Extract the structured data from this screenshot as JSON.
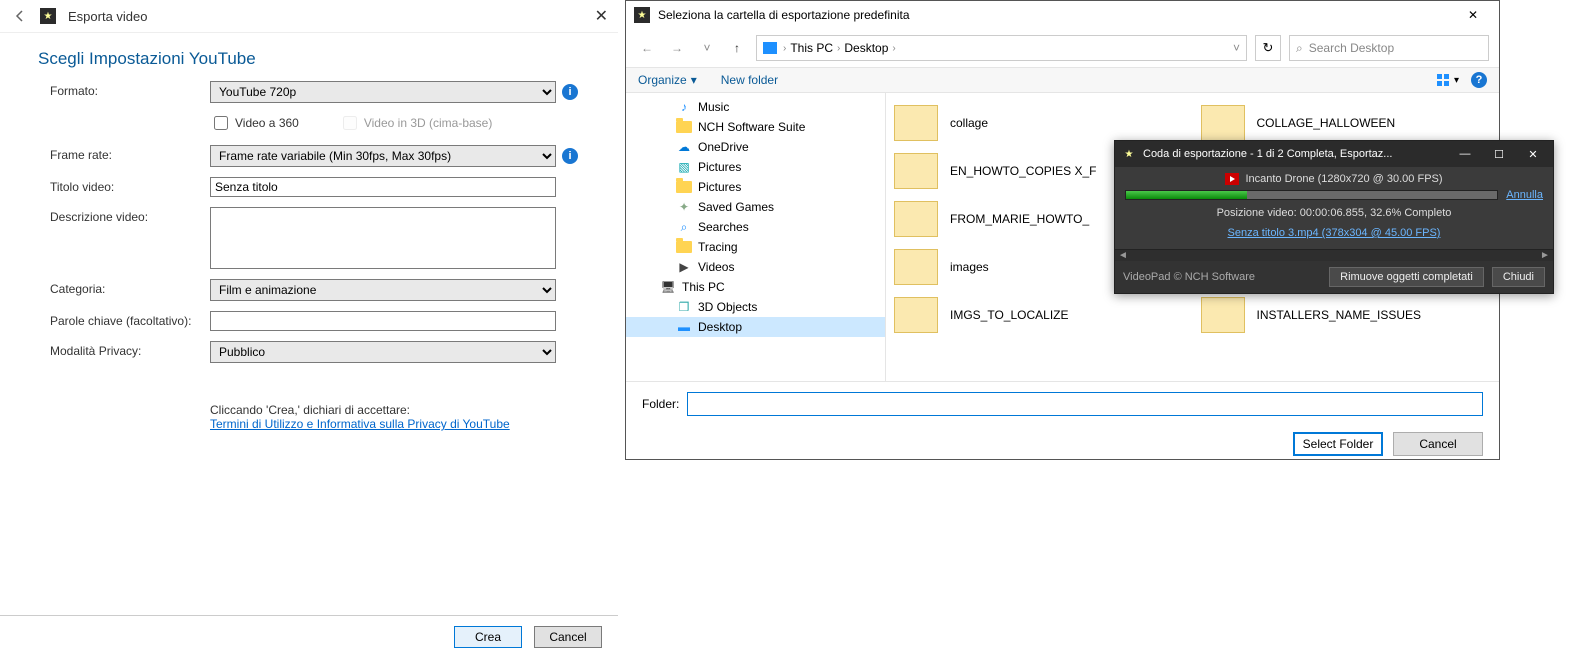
{
  "export": {
    "title": "Esporta video",
    "section_title": "Scegli Impostazioni YouTube",
    "labels": {
      "formato": "Formato:",
      "frame_rate": "Frame rate:",
      "titolo": "Titolo video:",
      "descrizione": "Descrizione video:",
      "categoria": "Categoria:",
      "parole": "Parole chiave (facoltativo):",
      "privacy": "Modalità Privacy:",
      "video360": "Video a 360",
      "video3d": "Video in 3D (cima-base)"
    },
    "values": {
      "formato": "YouTube 720p",
      "frame_rate": "Frame rate variabile (Min 30fps, Max 30fps)",
      "titolo": "Senza titolo",
      "descrizione": "",
      "categoria": "Film e animazione",
      "parole": "",
      "privacy": "Pubblico"
    },
    "accept_text": "Cliccando 'Crea,' dichiari di accettare:",
    "terms_link": "Termini di Utilizzo e Informativa sulla Privacy di YouTube",
    "buttons": {
      "crea": "Crea",
      "cancel": "Cancel"
    }
  },
  "folder_dialog": {
    "title": "Seleziona la cartella di esportazione predefinita",
    "breadcrumb": [
      "This PC",
      "Desktop"
    ],
    "refresh": "↻",
    "search_placeholder": "Search Desktop",
    "toolbar": {
      "organize": "Organize",
      "newfolder": "New folder"
    },
    "tree": [
      {
        "label": "Music",
        "icon": "music",
        "indent": true
      },
      {
        "label": "NCH Software Suite",
        "icon": "folder",
        "indent": true
      },
      {
        "label": "OneDrive",
        "icon": "onedrive",
        "indent": true
      },
      {
        "label": "Pictures",
        "icon": "pictures",
        "indent": true
      },
      {
        "label": "Pictures",
        "icon": "folder",
        "indent": true
      },
      {
        "label": "Saved Games",
        "icon": "games",
        "indent": true
      },
      {
        "label": "Searches",
        "icon": "search",
        "indent": true
      },
      {
        "label": "Tracing",
        "icon": "folder",
        "indent": true
      },
      {
        "label": "Videos",
        "icon": "videos",
        "indent": true
      },
      {
        "label": "This PC",
        "icon": "pc",
        "indent": false
      },
      {
        "label": "3D Objects",
        "icon": "3d",
        "indent": true
      },
      {
        "label": "Desktop",
        "icon": "desktop",
        "indent": true,
        "selected": true
      }
    ],
    "files": [
      "collage",
      "COLLAGE_HALLOWEEN",
      "EN_HOWTO_COPIES X_F",
      "",
      "FROM_MARIE_HOWTO_",
      "",
      "images",
      "",
      "IMGS_TO_LOCALIZE",
      "INSTALLERS_NAME_ISSUES"
    ],
    "folder_label": "Folder:",
    "folder_value": "",
    "buttons": {
      "select": "Select Folder",
      "cancel": "Cancel"
    }
  },
  "queue": {
    "title": "Coda di esportazione - 1 di 2 Completa, Esportaz...",
    "item1": "Incanto Drone (1280x720 @ 30.00 FPS)",
    "progress_pct": 32.6,
    "cancel": "Annulla",
    "status": "Posizione video:  00:00:06.855, 32.6% Completo",
    "next": "Senza titolo 3.mp4 (378x304 @ 45.00 FPS)",
    "brand": "VideoPad © NCH Software",
    "buttons": {
      "remove": "Rimuove oggetti completati",
      "close": "Chiudi"
    }
  }
}
